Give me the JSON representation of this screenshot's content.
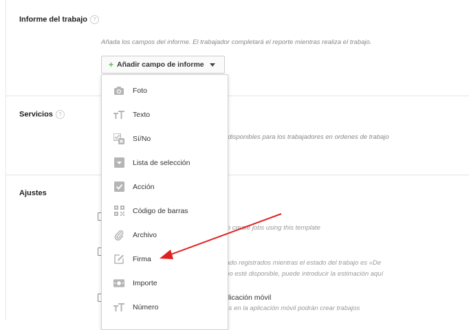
{
  "report_section": {
    "title": "Informe del trabajo",
    "help": "?",
    "description": "Añada los campos del informe. El trabajador completará el reporte mientras realiza el trabajo.",
    "add_button": {
      "plus": "+",
      "label": "Añadir campo de informe"
    }
  },
  "field_menu": {
    "items": [
      {
        "label": "Foto",
        "icon": "camera-icon"
      },
      {
        "label": "Texto",
        "icon": "text-icon"
      },
      {
        "label": "Sí/No",
        "icon": "yes-no-icon"
      },
      {
        "label": "Lista de selección",
        "icon": "dropdown-list-icon"
      },
      {
        "label": "Acción",
        "icon": "checkmark-icon"
      },
      {
        "label": "Código de barras",
        "icon": "barcode-icon"
      },
      {
        "label": "Archivo",
        "icon": "paperclip-icon"
      },
      {
        "label": "Firma",
        "icon": "signature-icon"
      },
      {
        "label": "Importe",
        "icon": "money-icon"
      },
      {
        "label": "Número",
        "icon": "number-icon"
      }
    ]
  },
  "services_section": {
    "title": "Servicios",
    "help": "?",
    "description_partial": "án disponibles para los trabajadores en ordenes de trabajo"
  },
  "settings_section": {
    "title": "Ajustes",
    "option1_desc_partial": "er to create jobs using this template",
    "option2_desc_line1_partial": "gnado registrados mientras el estado del trabajo es «De",
    "option2_desc_line2_partial": "je no esté disponible, puede introducir la estimación aquí",
    "option3_label_partial": "plicación móvil",
    "option3_desc_partial": "ajos en la aplicación móvil podrán crear trabajos"
  },
  "colors": {
    "arrow": "#e02020",
    "accent_plus": "#5cb85c",
    "icon_gray": "#b5b5b5"
  }
}
